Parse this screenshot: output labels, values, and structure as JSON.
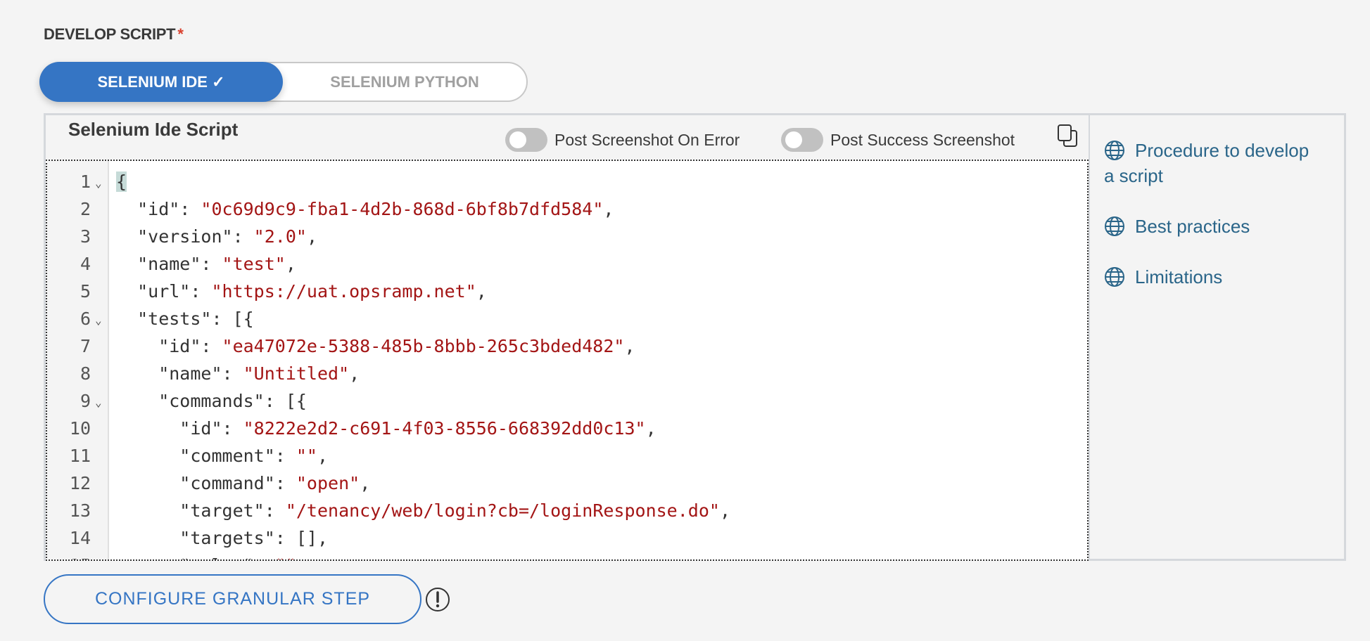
{
  "section_label": "DEVELOP SCRIPT",
  "required_mark": "*",
  "script_type": {
    "options": [
      "SELENIUM IDE",
      "SELENIUM PYTHON"
    ],
    "selected": "SELENIUM IDE",
    "check": "✓"
  },
  "panel": {
    "title": "Selenium Ide Script",
    "toggles": [
      {
        "label": "Post Screenshot On Error",
        "on": false
      },
      {
        "label": "Post Success Screenshot",
        "on": false
      }
    ],
    "copy_icon": "copy-icon",
    "code_lines": [
      [
        {
          "t": "{",
          "c": "br"
        }
      ],
      [
        {
          "t": "  \"id\": "
        },
        {
          "t": "\"0c69d9c9-fba1-4d2b-868d-6bf8b7dfd584\"",
          "c": "s"
        },
        {
          "t": ","
        }
      ],
      [
        {
          "t": "  \"version\": "
        },
        {
          "t": "\"2.0\"",
          "c": "s"
        },
        {
          "t": ","
        }
      ],
      [
        {
          "t": "  \"name\": "
        },
        {
          "t": "\"test\"",
          "c": "s"
        },
        {
          "t": ","
        }
      ],
      [
        {
          "t": "  \"url\": "
        },
        {
          "t": "\"https://uat.opsramp.net\"",
          "c": "s"
        },
        {
          "t": ","
        }
      ],
      [
        {
          "t": "  \"tests\": [{"
        }
      ],
      [
        {
          "t": "    \"id\": "
        },
        {
          "t": "\"ea47072e-5388-485b-8bbb-265c3bded482\"",
          "c": "s"
        },
        {
          "t": ","
        }
      ],
      [
        {
          "t": "    \"name\": "
        },
        {
          "t": "\"Untitled\"",
          "c": "s"
        },
        {
          "t": ","
        }
      ],
      [
        {
          "t": "    \"commands\": [{"
        }
      ],
      [
        {
          "t": "      \"id\": "
        },
        {
          "t": "\"8222e2d2-c691-4f03-8556-668392dd0c13\"",
          "c": "s"
        },
        {
          "t": ","
        }
      ],
      [
        {
          "t": "      \"comment\": "
        },
        {
          "t": "\"\"",
          "c": "s"
        },
        {
          "t": ","
        }
      ],
      [
        {
          "t": "      \"command\": "
        },
        {
          "t": "\"open\"",
          "c": "s"
        },
        {
          "t": ","
        }
      ],
      [
        {
          "t": "      \"target\": "
        },
        {
          "t": "\"/tenancy/web/login?cb=/loginResponse.do\"",
          "c": "s"
        },
        {
          "t": ","
        }
      ],
      [
        {
          "t": "      \"targets\": [],"
        }
      ],
      [
        {
          "t": "      \"value\": "
        },
        {
          "t": "\"\"",
          "c": "s"
        }
      ]
    ],
    "foldable_lines": [
      1,
      6,
      9
    ]
  },
  "help_links": [
    {
      "label": "Procedure to develop a script",
      "icon": "globe-icon"
    },
    {
      "label": "Best practices",
      "icon": "globe-icon"
    },
    {
      "label": "Limitations",
      "icon": "globe-icon"
    }
  ],
  "configure_button": "CONFIGURE GRANULAR STEP",
  "info_icon": "exclamation-circle-icon",
  "colors": {
    "accent": "#3575c4",
    "link": "#2a6589",
    "string": "#a31515",
    "required": "#d9412e"
  }
}
